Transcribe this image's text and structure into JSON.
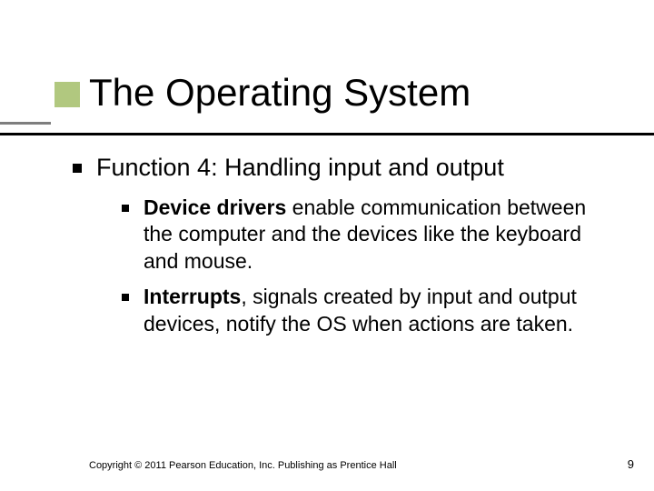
{
  "title": "The Operating System",
  "body": {
    "lvl1_text": "Function 4: Handling input and output",
    "items": [
      {
        "bold": "Device drivers",
        "rest": " enable communication between the computer and the devices like the keyboard and mouse."
      },
      {
        "bold": "Interrupts",
        "rest": ", signals created by input and output devices, notify the OS when actions are taken."
      }
    ]
  },
  "footer": "Copyright © 2011 Pearson Education, Inc. Publishing as Prentice Hall",
  "page_number": "9"
}
